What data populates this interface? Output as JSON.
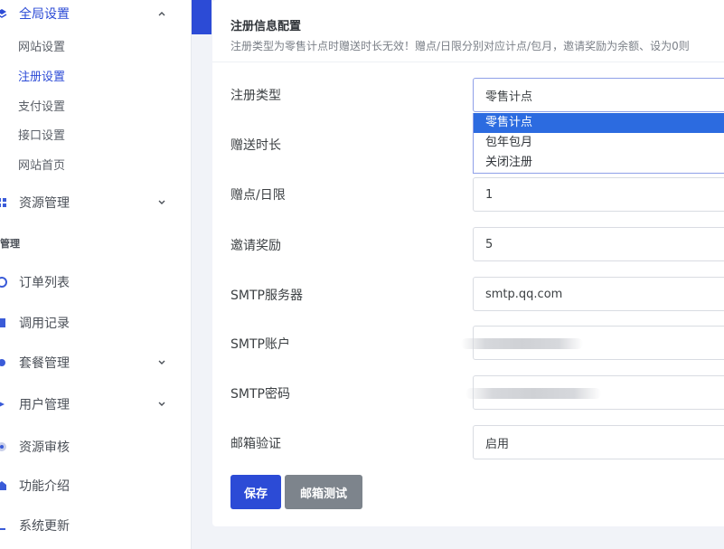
{
  "sidebar": {
    "groups": [
      {
        "label": "全局设置",
        "color": "#2c4bd6"
      },
      {
        "label": "资源管理"
      },
      {
        "label": "订单列表"
      },
      {
        "label": "调用记录"
      },
      {
        "label": "套餐管理"
      },
      {
        "label": "用户管理"
      },
      {
        "label": "资源审核"
      },
      {
        "label": "功能介绍"
      },
      {
        "label": "系统更新"
      }
    ],
    "sub_items": [
      "网站设置",
      "注册设置",
      "支付设置",
      "接口设置",
      "网站首页"
    ],
    "section_label": "管理"
  },
  "card": {
    "title": "注册信息配置",
    "description": "注册类型为零售计点时赠送时长无效！赠点/日限分别对应计点/包月，邀请奖励为余额、设为0则"
  },
  "form": {
    "reg_type": {
      "label": "注册类型",
      "value": "零售计点",
      "options": [
        "零售计点",
        "包年包月",
        "关闭注册"
      ]
    },
    "gift_duration": {
      "label": "赠送时长"
    },
    "gift_points": {
      "label": "赠点/日限",
      "value": "1"
    },
    "invite_reward": {
      "label": "邀请奖励",
      "value": "5"
    },
    "smtp_server": {
      "label": "SMTP服务器",
      "value": "smtp.qq.com"
    },
    "smtp_account": {
      "label": "SMTP账户"
    },
    "smtp_password": {
      "label": "SMTP密码"
    },
    "mail_verify": {
      "label": "邮箱验证",
      "value": "启用"
    }
  },
  "buttons": {
    "save": "保存",
    "mail_test": "邮箱测试"
  },
  "colors": {
    "primary": "#2c4bd6",
    "secondary_button": "#7d848c",
    "dropdown_selected": "#2c6be0"
  }
}
